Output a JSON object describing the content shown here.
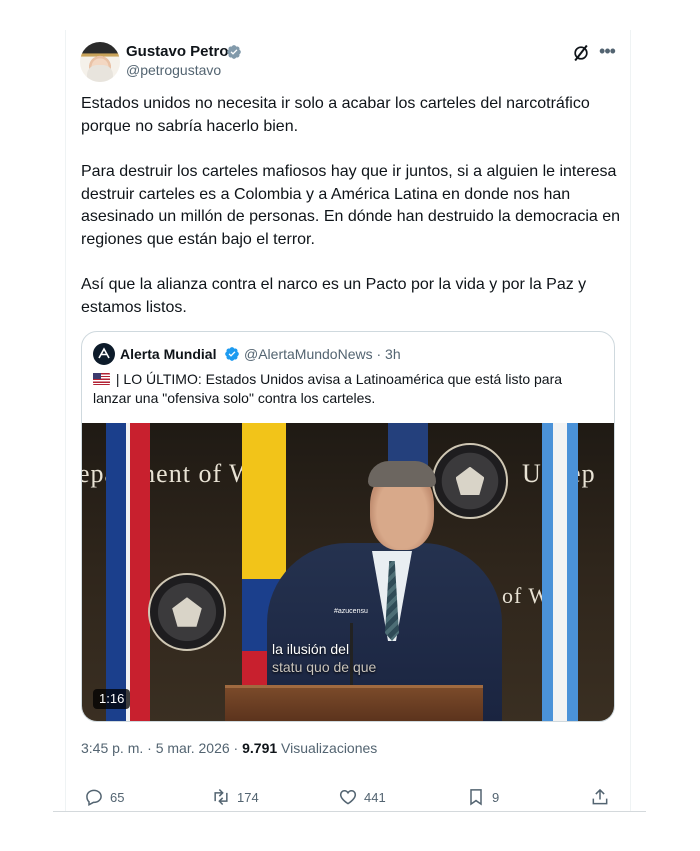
{
  "tweet": {
    "author_name": "Gustavo Petro",
    "author_handle": "@petrogustavo",
    "paragraphs": [
      "Estados unidos no necesita ir solo a acabar los carteles del narcotráfico porque no sabría hacerlo bien.",
      "Para destruir los carteles mafiosos hay que ir juntos, si a alguien le interesa destruir carteles es a Colombia y a América Latina en donde nos han asesinado un millón de personas. En dónde han destruido la democracia en regiones que están bajo el terror.",
      "Así que la alianza contra el narco es un Pacto por la vida y por la Paz y estamos listos."
    ],
    "time": "3:45 p. m.",
    "separator": "·",
    "date": "5 mar. 2026",
    "views_count": "9.791",
    "views_label": "Visualizaciones"
  },
  "quote": {
    "author_name": "Alerta Mundial",
    "author_handle": "@AlertaMundoNews",
    "age": "· 3h",
    "text": "| LO ÚLTIMO: Estados Unidos avisa a Latinoamérica que está listo para lanzar una \"ofensiva solo\" contra los carteles.",
    "video": {
      "wall_text_left": "epartment of War",
      "wall_text_right": "U Dep",
      "wall_text_small": "of W",
      "tag": "#azucensu",
      "caption_line1": "la ilusión del",
      "caption_line2": "statu quo de que",
      "duration": "1:16"
    }
  },
  "actions": {
    "replies": "65",
    "reposts": "174",
    "likes": "441",
    "bookmarks": "9"
  },
  "icons": [
    "verified-badge-icon",
    "grok-icon",
    "more-icon",
    "reply-icon",
    "repost-icon",
    "like-icon",
    "bookmark-icon",
    "share-icon"
  ],
  "colors": {
    "text": "#0f1419",
    "secondary": "#536471",
    "verified": "#1d9bf0",
    "border": "#cfd9de"
  }
}
